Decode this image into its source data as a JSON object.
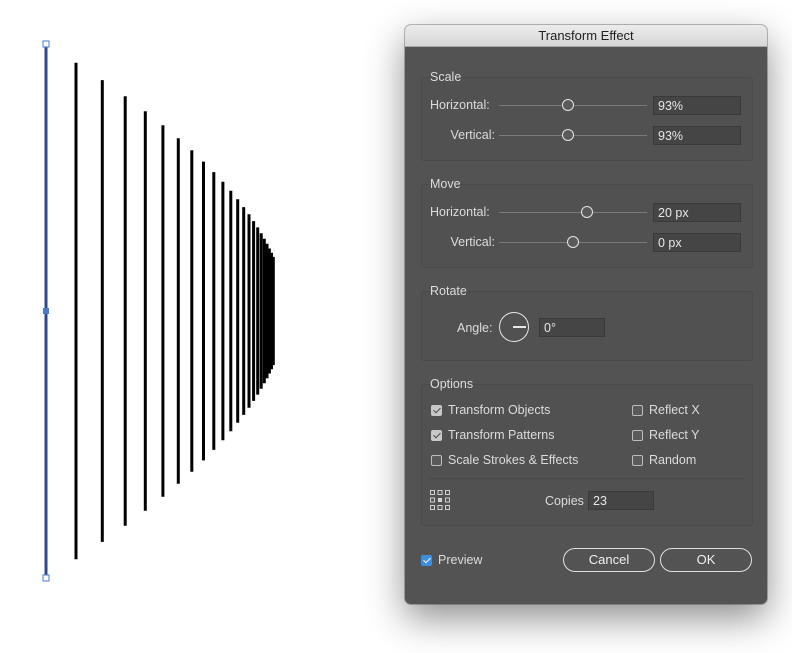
{
  "canvas": {
    "line_count": 22
  },
  "dialog": {
    "title": "Transform Effect",
    "scale": {
      "title": "Scale",
      "horizontal_label": "Horizontal:",
      "horizontal_value": "93%",
      "vertical_label": "Vertical:",
      "vertical_value": "93%"
    },
    "move": {
      "title": "Move",
      "horizontal_label": "Horizontal:",
      "horizontal_value": "20 px",
      "vertical_label": "Vertical:",
      "vertical_value": "0 px"
    },
    "rotate": {
      "title": "Rotate",
      "angle_label": "Angle:",
      "angle_value": "0°"
    },
    "options": {
      "title": "Options",
      "transform_objects": "Transform Objects",
      "transform_patterns": "Transform Patterns",
      "scale_strokes": "Scale Strokes & Effects",
      "reflect_x": "Reflect X",
      "reflect_y": "Reflect Y",
      "random": "Random",
      "copies_label": "Copies",
      "copies_value": "23"
    },
    "preview_label": "Preview",
    "cancel_label": "Cancel",
    "ok_label": "OK"
  }
}
